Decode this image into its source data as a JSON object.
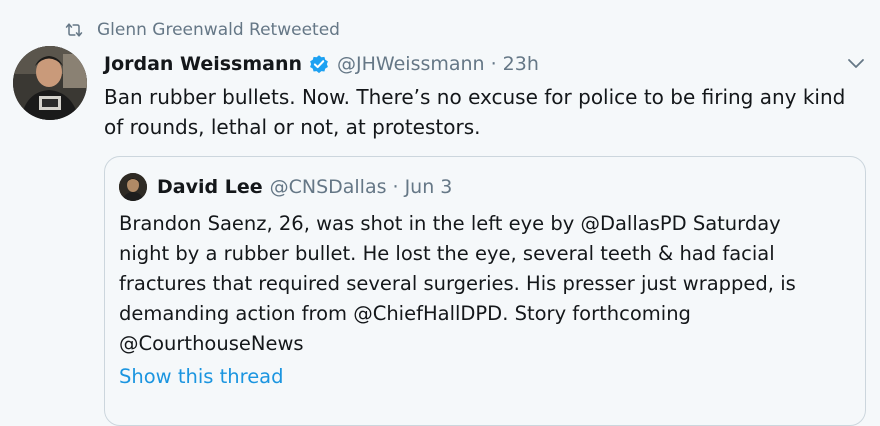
{
  "retweet": {
    "icon": "retweet-icon",
    "label": "Glenn Greenwald Retweeted"
  },
  "tweet": {
    "author_name": "Jordan Weissmann",
    "verified": true,
    "handle": "@JHWeissmann",
    "separator": "·",
    "time": "23h",
    "text": "Ban rubber bullets. Now. There’s no excuse for police to be firing any kind of rounds, lethal or not, at protestors."
  },
  "quoted_tweet": {
    "author_name": "David Lee",
    "handle": "@CNSDallas",
    "separator": "·",
    "date": "Jun 3",
    "text_lines": [
      "Brandon Saenz, 26, was shot in the left eye by @DallasPD Saturday",
      "night by a rubber bullet. He lost the eye, several teeth & had facial",
      "fractures that required several surgeries. His presser just wrapped, is",
      "demanding action from @ChiefHallDPD. Story forthcoming",
      "@CourthouseNews"
    ],
    "show_thread": "Show this thread"
  },
  "colors": {
    "background": "#f5f8fa",
    "text": "#14171a",
    "secondary": "#657786",
    "link": "#1b95e0",
    "verified": "#1da1f2",
    "border": "#ccd6dd"
  }
}
